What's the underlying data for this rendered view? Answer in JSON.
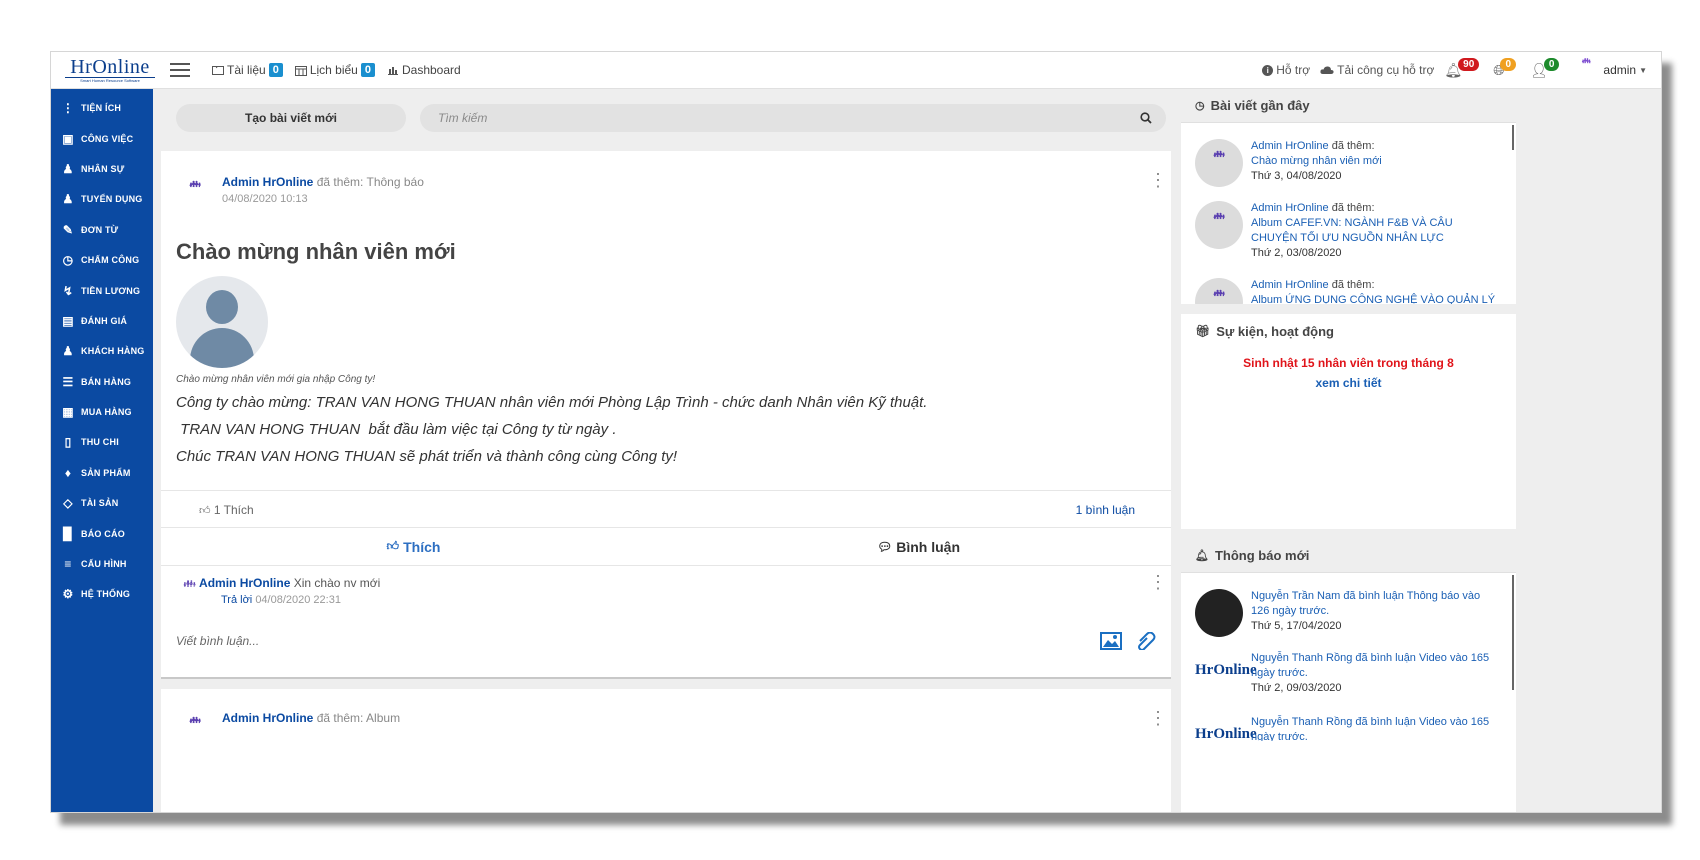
{
  "logo": {
    "title": "HrOnline",
    "subtitle": "Smart Human Resource Software"
  },
  "topnav": {
    "documents": "Tài liệu",
    "documents_count": "0",
    "calendar": "Lịch biểu",
    "calendar_count": "0",
    "dashboard": "Dashboard"
  },
  "topright": {
    "support": "Hỗ trợ",
    "download_tools": "Tải công cụ hỗ trợ",
    "notif_bell": "90",
    "notif_globe": "0",
    "notif_user": "0",
    "user": "admin"
  },
  "sidebar": {
    "items": [
      {
        "label": "TIỆN ÍCH",
        "icon": "more-vertical-icon"
      },
      {
        "label": "CÔNG VIỆC",
        "icon": "inbox-icon"
      },
      {
        "label": "NHÂN SỰ",
        "icon": "user-icon"
      },
      {
        "label": "TUYỂN DỤNG",
        "icon": "user-icon"
      },
      {
        "label": "ĐƠN TỪ",
        "icon": "edit-icon"
      },
      {
        "label": "CHẤM CÔNG",
        "icon": "gauge-icon"
      },
      {
        "label": "TIỀN LƯƠNG",
        "icon": "lightning-icon"
      },
      {
        "label": "ĐÁNH GIÁ",
        "icon": "book-icon"
      },
      {
        "label": "KHÁCH HÀNG",
        "icon": "user-icon"
      },
      {
        "label": "BÁN HÀNG",
        "icon": "menu-icon"
      },
      {
        "label": "MUA HÀNG",
        "icon": "map-icon"
      },
      {
        "label": "THU CHI",
        "icon": "file-icon"
      },
      {
        "label": "SẢN PHẨM",
        "icon": "tag-icon"
      },
      {
        "label": "TÀI SẢN",
        "icon": "diamond-icon"
      },
      {
        "label": "BÁO CÁO",
        "icon": "bar-chart-icon"
      },
      {
        "label": "CẤU HÌNH",
        "icon": "layers-icon"
      },
      {
        "label": "HỆ THỐNG",
        "icon": "gear-icon"
      }
    ]
  },
  "feed": {
    "new_post": "Tạo bài viết mới",
    "search_placeholder": "Tìm kiếm",
    "post": {
      "author": "Admin HrOnline",
      "action": "đã thêm: Thông báo",
      "time": "04/08/2020 10:13",
      "title": "Chào mừng nhân viên mới",
      "caption": "Chào mừng nhân viên mới gia nhập Công ty!",
      "body_line1": "Công ty chào mừng: TRAN VAN HONG THUAN  nhân viên mới Phòng Lập Trình - chức danh Nhân viên Kỹ thuật.",
      "body_line2": " TRAN VAN HONG THUAN  bắt đầu làm việc tại Công ty từ ngày .",
      "body_line3": "Chúc TRAN VAN HONG THUAN sẽ phát triển và thành công cùng Công ty!",
      "likes": "1 Thích",
      "comments_count": "1 bình luận",
      "like_action": "Thích",
      "comment_action": "Bình luận",
      "comment": {
        "author": "Admin HrOnline",
        "text": "Xin chào nv mới",
        "reply": "Trả lời",
        "time": "04/08/2020 22:31"
      },
      "comment_placeholder": "Viết bình luận..."
    },
    "post2": {
      "author": "Admin HrOnline",
      "action": "đã thêm: Album"
    }
  },
  "recent_posts": {
    "title": "Bài viết gần đây",
    "items": [
      {
        "who": "Admin HrOnline",
        "verb": "đã thêm:",
        "link": "Chào mừng nhân viên mới",
        "date": "Thứ 3, 04/08/2020"
      },
      {
        "who": "Admin HrOnline",
        "verb": "đã thêm:",
        "link": "Album CAFEF.VN: NGÀNH F&B VÀ CÂU CHUYỆN TỐI ƯU NGUỒN NHÂN LỰC",
        "date": "Thứ 2, 03/08/2020"
      },
      {
        "who": "Admin HrOnline",
        "verb": "đã thêm:",
        "link": "Album ỨNG DỤNG CÔNG NGHỆ VÀO QUẢN LÝ",
        "date": ""
      }
    ]
  },
  "events": {
    "title": "Sự kiện, hoạt động",
    "birthday": "Sinh nhật 15 nhân viên trong tháng 8",
    "details": "xem chi tiết"
  },
  "notifications": {
    "title": "Thông báo mới",
    "items": [
      {
        "text": "Nguyễn Trần Nam đã bình luận Thông báo vào 126 ngày trước.",
        "date": "Thứ 5, 17/04/2020"
      },
      {
        "text": "Nguyễn Thanh Rồng đã bình luận Video vào 165 ngày trước.",
        "date": "Thứ 2, 09/03/2020"
      },
      {
        "text": "Nguyễn Thanh Rồng đã bình luận Video vào 165 ngày trước.",
        "date": ""
      }
    ]
  },
  "colors": {
    "sidebar": "#0b4aa2",
    "link": "#1a5fb4",
    "alert_red": "#e0141a"
  }
}
